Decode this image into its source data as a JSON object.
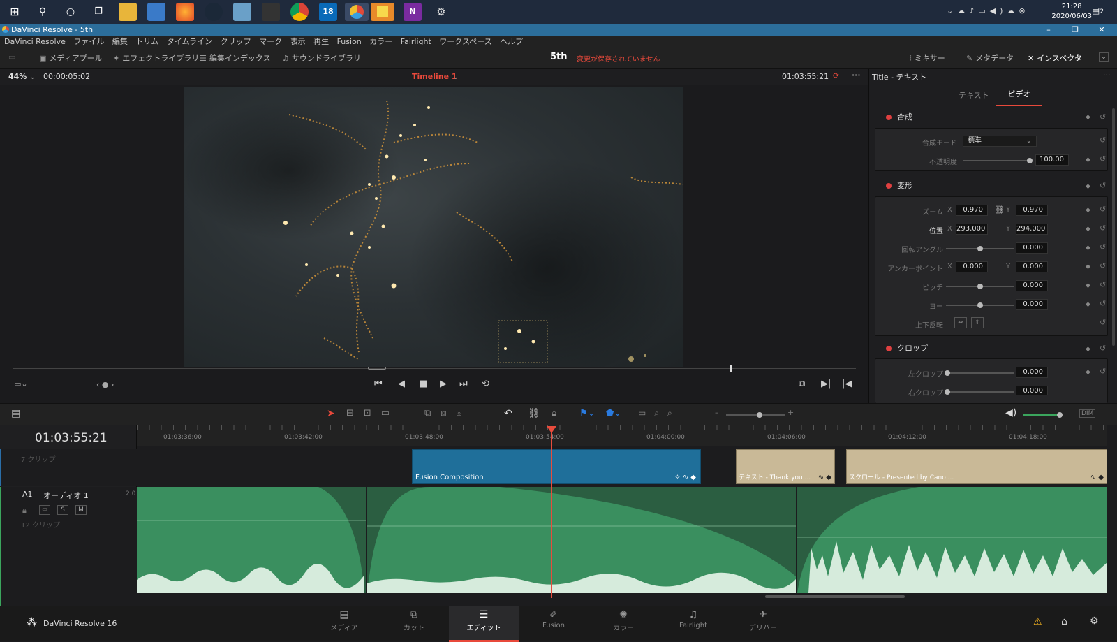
{
  "taskbar": {
    "clock_time": "21:28",
    "clock_date": "2020/06/03",
    "notification_count": "2"
  },
  "titlebar": {
    "title": "DaVinci Resolve - 5th"
  },
  "menu": [
    "DaVinci Resolve",
    "ファイル",
    "編集",
    "トリム",
    "タイムライン",
    "クリップ",
    "マーク",
    "表示",
    "再生",
    "Fusion",
    "カラー",
    "Fairlight",
    "ワークスペース",
    "ヘルプ"
  ],
  "toolbar": {
    "media_pool": "メディアプール",
    "effects_library": "エフェクトライブラリ",
    "edit_index": "編集インデックス",
    "sound_library": "サウンドライブラリ",
    "project_name": "5th",
    "unsaved": "変更が保存されていません",
    "mixer": "ミキサー",
    "metadata": "メタデータ",
    "inspector": "インスペクタ"
  },
  "viewer": {
    "zoom": "44%",
    "duration": "00:00:05:02",
    "timeline_name": "Timeline 1",
    "timecode": "01:03:55:21"
  },
  "inspector": {
    "title": "Title - テキスト",
    "tab_text": "テキスト",
    "tab_video": "ビデオ",
    "composite": {
      "header": "合成",
      "mode_label": "合成モード",
      "mode_value": "標準",
      "opacity_label": "不透明度",
      "opacity_value": "100.00",
      "opacity_level": 1.0
    },
    "transform": {
      "header": "変形",
      "zoom_label": "ズーム",
      "zoom_x": "0.970",
      "zoom_y": "0.970",
      "position_label": "位置",
      "position_x": "293.000",
      "position_y": "294.000",
      "rotation_label": "回転アングル",
      "rotation_value": "0.000",
      "anchor_label": "アンカーポイント",
      "anchor_x": "0.000",
      "anchor_y": "0.000",
      "pitch_label": "ピッチ",
      "pitch_value": "0.000",
      "yaw_label": "ヨー",
      "yaw_value": "0.000",
      "flip_label": "上下反転",
      "x_label": "X",
      "y_label": "Y"
    },
    "crop": {
      "header": "クロップ",
      "left_label": "左クロップ",
      "left_value": "0.000",
      "right_label": "右クロップ",
      "right_value": "0.000"
    }
  },
  "timeline": {
    "timecode": "01:03:55:21",
    "ruler": [
      "01:03:36:00",
      "01:03:42:00",
      "01:03:48:00",
      "01:03:54:00",
      "01:04:00:00",
      "01:04:06:00",
      "01:04:12:00",
      "01:04:18:00"
    ],
    "video_track": {
      "clip_count": "7 クリップ"
    },
    "audio_track": {
      "id": "A1",
      "name": "オーディオ 1",
      "channels": "2.0",
      "solo": "S",
      "mute": "M",
      "clip_count": "12 クリップ"
    },
    "clips": [
      {
        "name": "Fusion Composition"
      },
      {
        "name": "テキスト - Thank you ..."
      },
      {
        "name": "スクロール - Presented by Cano ..."
      }
    ]
  },
  "pages": {
    "brand": "DaVinci Resolve 16",
    "items": [
      "メディア",
      "カット",
      "エディット",
      "Fusion",
      "カラー",
      "Fairlight",
      "デリバー"
    ],
    "active": "エディット"
  },
  "colors": {
    "accent_red": "#e8493b",
    "fusion_clip": "#1f6f9a",
    "title_clip": "#c9b997",
    "audio_clip": "#3a8f5f",
    "playhead": "#e84c3d"
  }
}
